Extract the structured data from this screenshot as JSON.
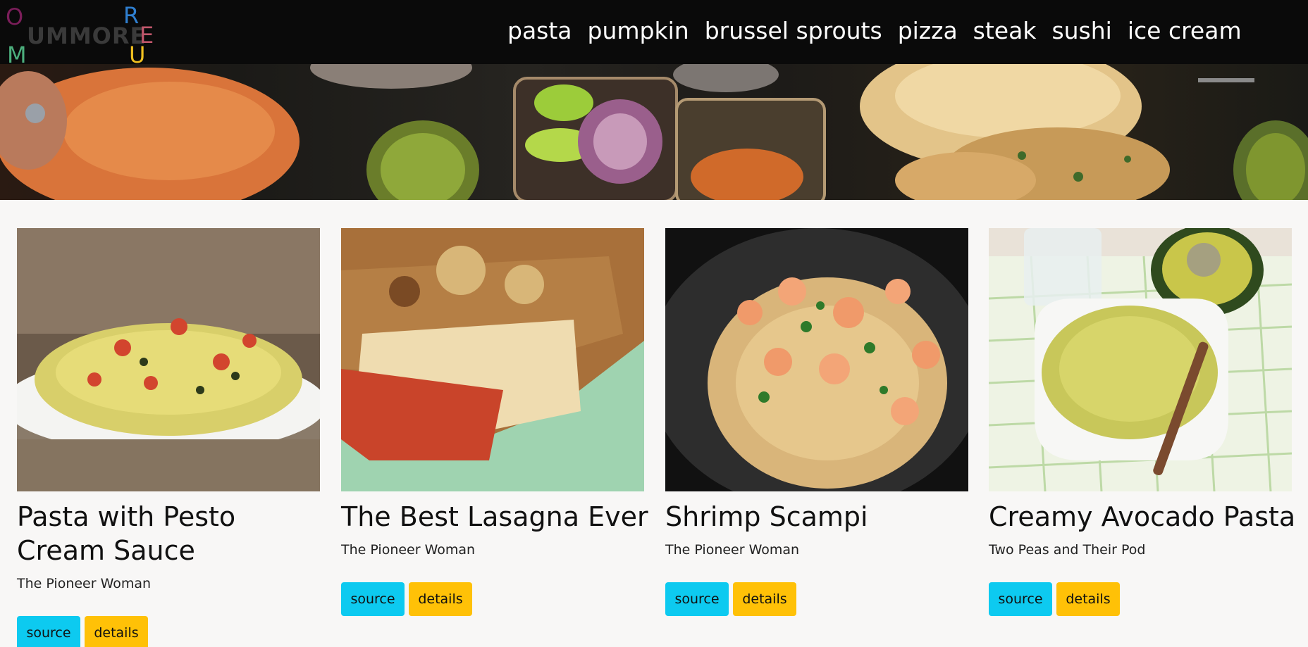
{
  "brand": {
    "wordmark": "UMMORE",
    "letters": [
      {
        "char": "O",
        "color": "#7b1e5a"
      },
      {
        "char": "M",
        "color": "#4caf7d"
      },
      {
        "char": "R",
        "color": "#2f7fd0"
      },
      {
        "char": "E",
        "color": "#c0566b"
      },
      {
        "char": "U",
        "color": "#f0c020"
      }
    ]
  },
  "nav": {
    "links": [
      "pasta",
      "pumpkin",
      "brussel sprouts",
      "pizza",
      "steak",
      "sushi",
      "ice cream"
    ]
  },
  "cards": [
    {
      "title": "Pasta with Pesto Cream Sauce",
      "source": "The Pioneer Woman",
      "source_button": "source",
      "details_button": "details"
    },
    {
      "title": "The Best Lasagna Ever",
      "source": "The Pioneer Woman",
      "source_button": "source",
      "details_button": "details"
    },
    {
      "title": "Shrimp Scampi",
      "source": "The Pioneer Woman",
      "source_button": "source",
      "details_button": "details"
    },
    {
      "title": "Creamy Avocado Pasta",
      "source": "Two Peas and Their Pod",
      "source_button": "source",
      "details_button": "details"
    }
  ],
  "colors": {
    "navbar": "#0a0a0a",
    "page_bg": "#f8f7f6",
    "source_button": "#0dcaf0",
    "details_button": "#ffc107"
  }
}
